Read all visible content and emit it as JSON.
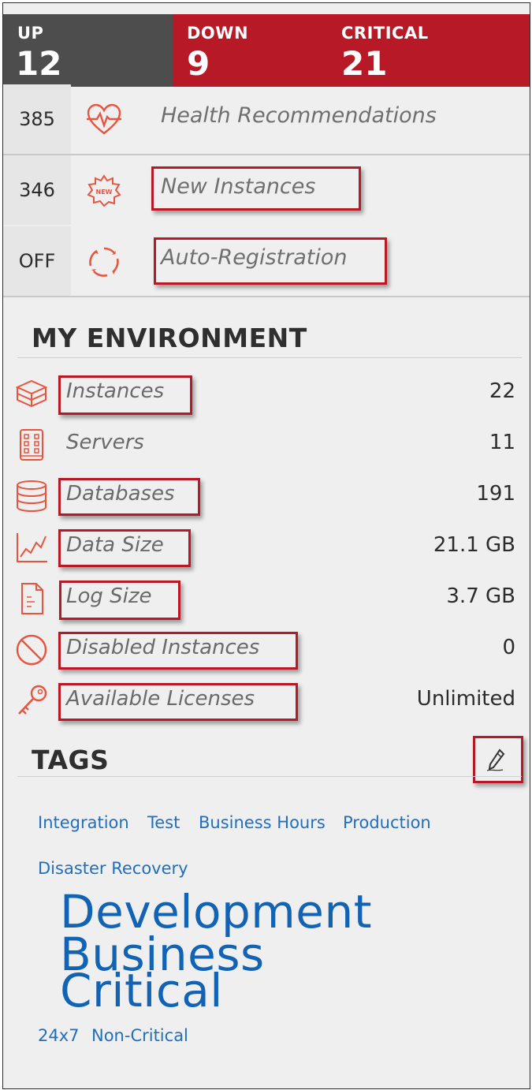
{
  "status": {
    "up": {
      "label": "UP",
      "count": "12"
    },
    "down": {
      "label": "DOWN",
      "count": "9"
    },
    "critical": {
      "label": "CRITICAL",
      "count": "21"
    }
  },
  "quick_links": [
    {
      "count": "385",
      "label": "Health Recommendations",
      "icon": "heartbeat-icon"
    },
    {
      "count": "346",
      "label": "New Instances",
      "icon": "new-badge-icon"
    },
    {
      "count": "OFF",
      "label": "Auto-Registration",
      "icon": "refresh-cycle-icon"
    }
  ],
  "environment": {
    "title": "MY ENVIRONMENT",
    "items": [
      {
        "label": "Instances",
        "value": "22",
        "icon": "instances-icon"
      },
      {
        "label": "Servers",
        "value": "11",
        "icon": "server-icon"
      },
      {
        "label": "Databases",
        "value": "191",
        "icon": "database-icon"
      },
      {
        "label": "Data Size",
        "value": "21.1 GB",
        "icon": "chart-line-icon"
      },
      {
        "label": "Log Size",
        "value": "3.7 GB",
        "icon": "log-file-icon"
      },
      {
        "label": "Disabled Instances",
        "value": "0",
        "icon": "disabled-icon"
      },
      {
        "label": "Available Licenses",
        "value": "Unlimited",
        "icon": "key-icon"
      }
    ]
  },
  "tags": {
    "title": "TAGS",
    "edit_icon": "pencil-icon",
    "items": [
      "Integration",
      "Test",
      "Business Hours",
      "Production",
      "Disaster Recovery",
      "Development",
      "Business",
      "Critical",
      "24x7",
      "Non-Critical"
    ]
  },
  "colors": {
    "accent": "#b71926",
    "icon": "#e8553f",
    "tag": "#1f6fbf",
    "up_bg": "#4d4d4d"
  }
}
